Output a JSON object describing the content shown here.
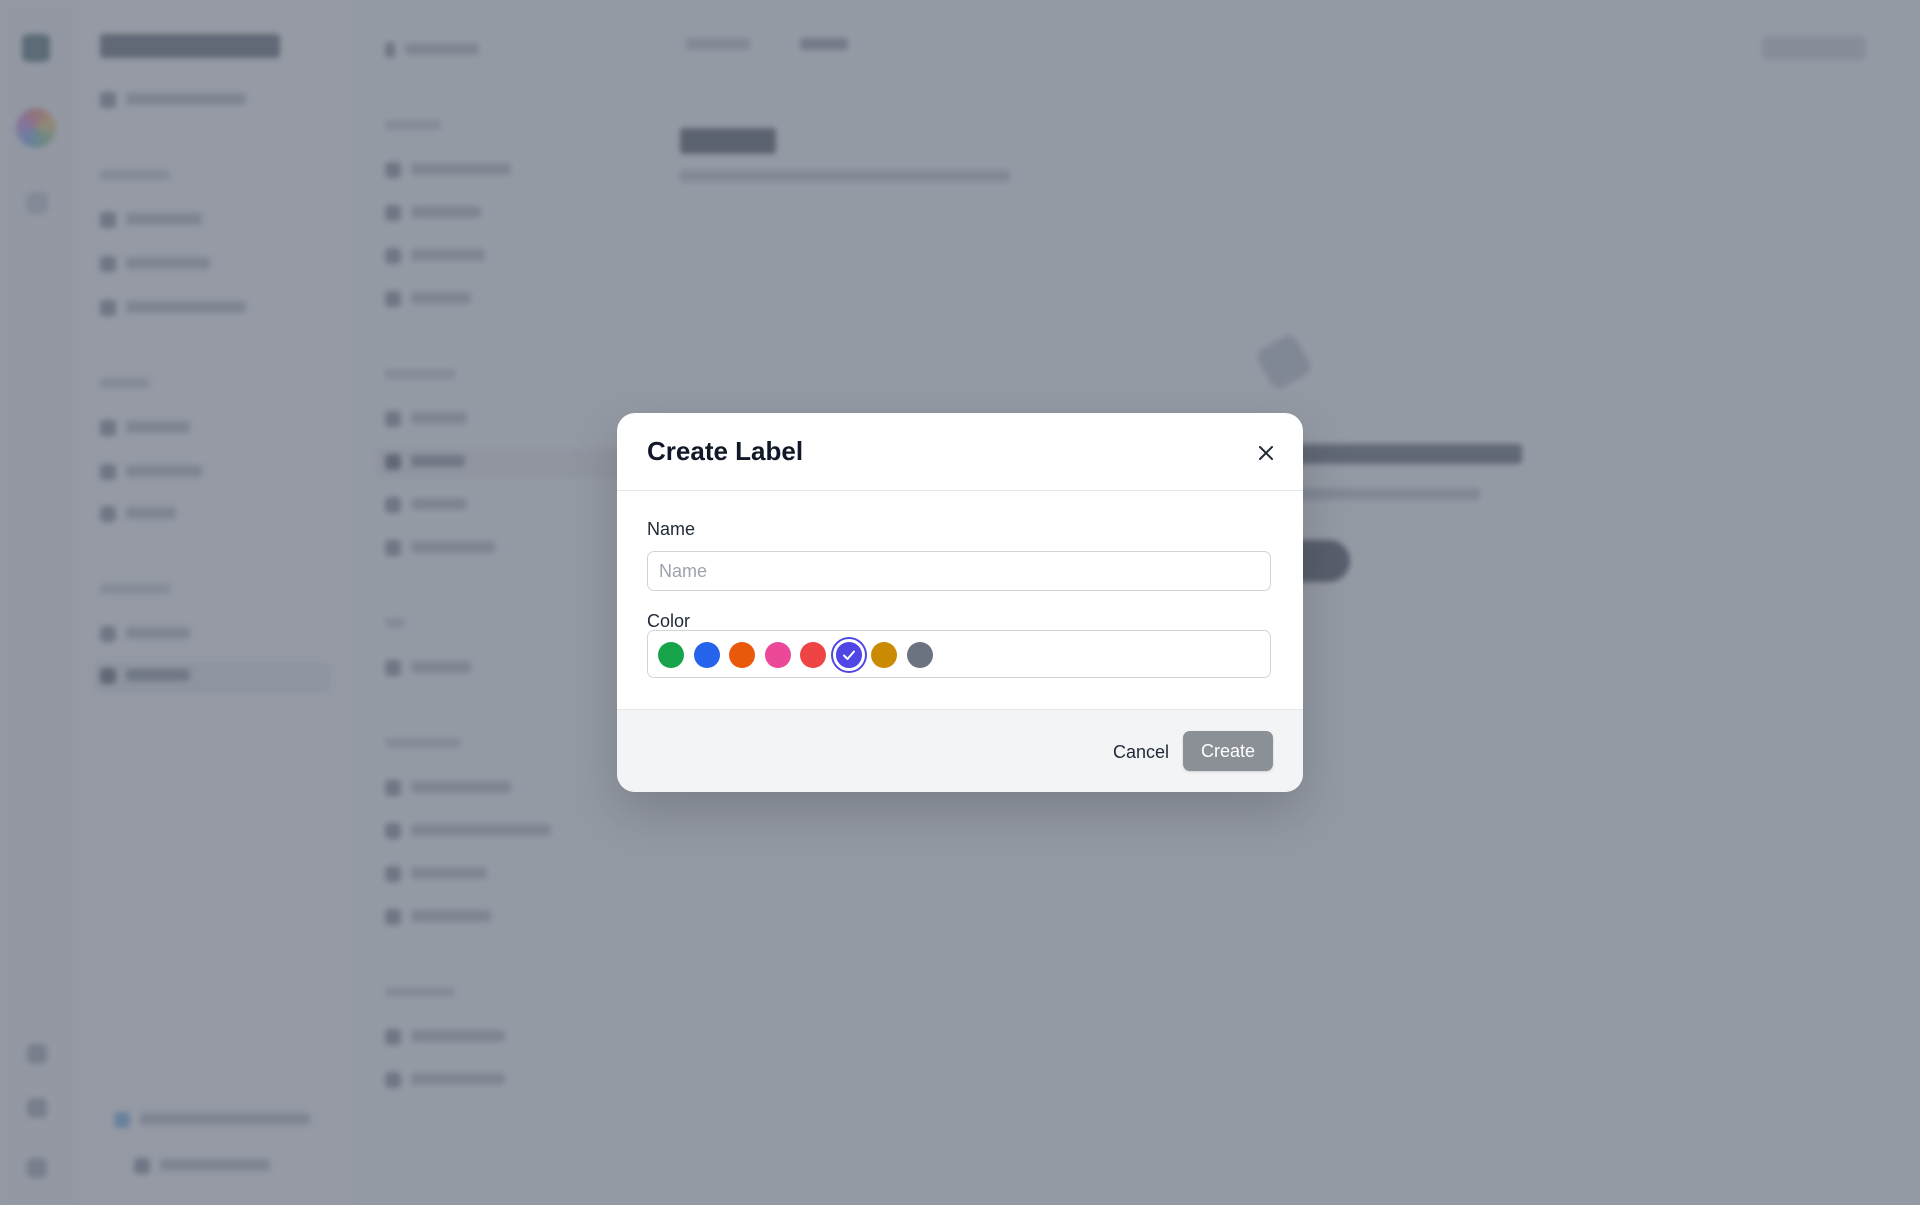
{
  "modal": {
    "title": "Create Label",
    "name_label": "Name",
    "name_placeholder": "Name",
    "name_value": "",
    "color_label": "Color",
    "colors": [
      {
        "name": "green",
        "hex": "#16a34a",
        "selected": false
      },
      {
        "name": "blue",
        "hex": "#2563eb",
        "selected": false
      },
      {
        "name": "orange",
        "hex": "#ea580c",
        "selected": false
      },
      {
        "name": "pink",
        "hex": "#ec4899",
        "selected": false
      },
      {
        "name": "red",
        "hex": "#ef4444",
        "selected": false
      },
      {
        "name": "indigo",
        "hex": "#4f46e5",
        "selected": true
      },
      {
        "name": "yellow",
        "hex": "#ca8a04",
        "selected": false
      },
      {
        "name": "gray",
        "hex": "#6b7280",
        "selected": false
      }
    ],
    "cancel_label": "Cancel",
    "create_label": "Create",
    "close_icon": "close-icon",
    "check_icon": "check-icon"
  }
}
